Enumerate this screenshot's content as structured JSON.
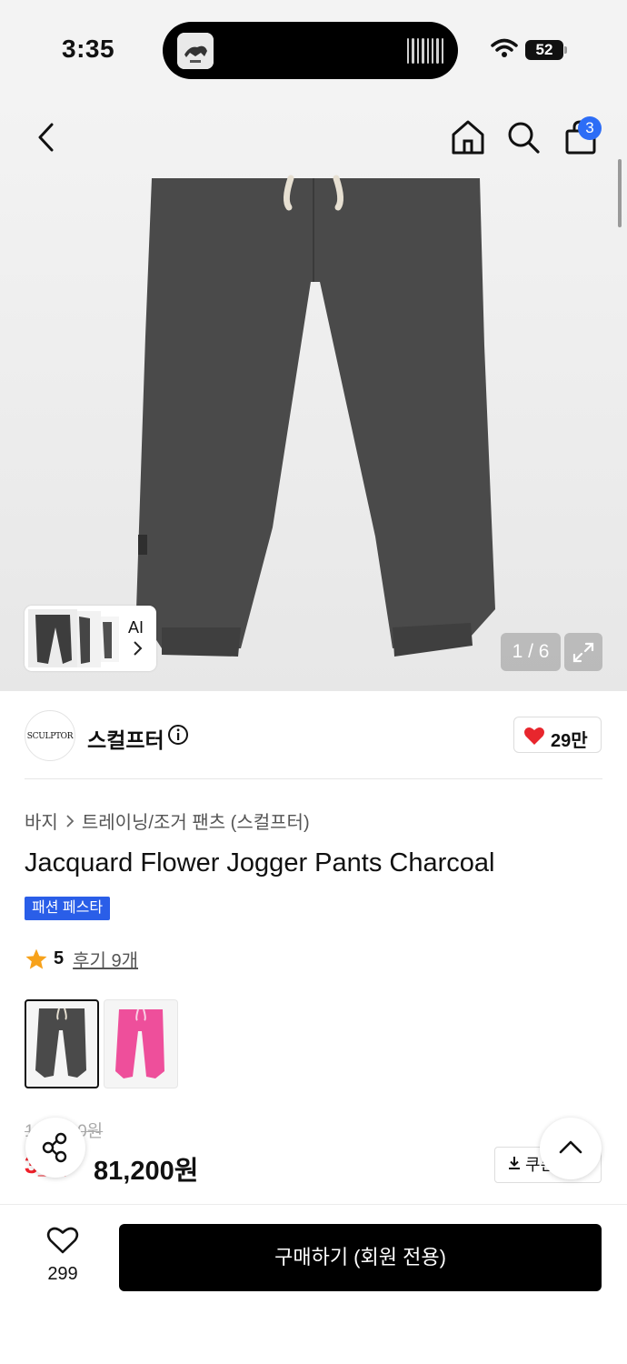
{
  "status": {
    "time": "3:35",
    "battery": "52"
  },
  "nav": {
    "back_icon": "chevron-left-icon",
    "home_icon": "home-icon",
    "search_icon": "search-icon",
    "cart_icon": "bag-icon",
    "cart_count": "3"
  },
  "gallery": {
    "counter": "1 / 6",
    "ai_label": "AI"
  },
  "brand": {
    "logo_text": "SCULPTOR",
    "name": "스컬프터",
    "likes": "29만"
  },
  "product": {
    "breadcrumb": [
      "바지",
      "트레이닝/조거 팬츠 (스컬프터)"
    ],
    "title": "Jacquard Flower Jogger Pants Charcoal",
    "tag": "패션 페스타",
    "rating": "5",
    "reviews": "후기 9개"
  },
  "price": {
    "original": "1__,_00원",
    "discount": "3__",
    "final": "81,200원",
    "coupon": "쿠폰"
  },
  "bottom": {
    "wish_count": "299",
    "buy_label": "구매하기 (회원 전용)"
  },
  "colors": {
    "accent": "#2a5ee8",
    "heart": "#e8262d",
    "sale": "#f0202a",
    "pants_charcoal": "#4a4a4a",
    "pants_pink": "#ee4f9b"
  }
}
